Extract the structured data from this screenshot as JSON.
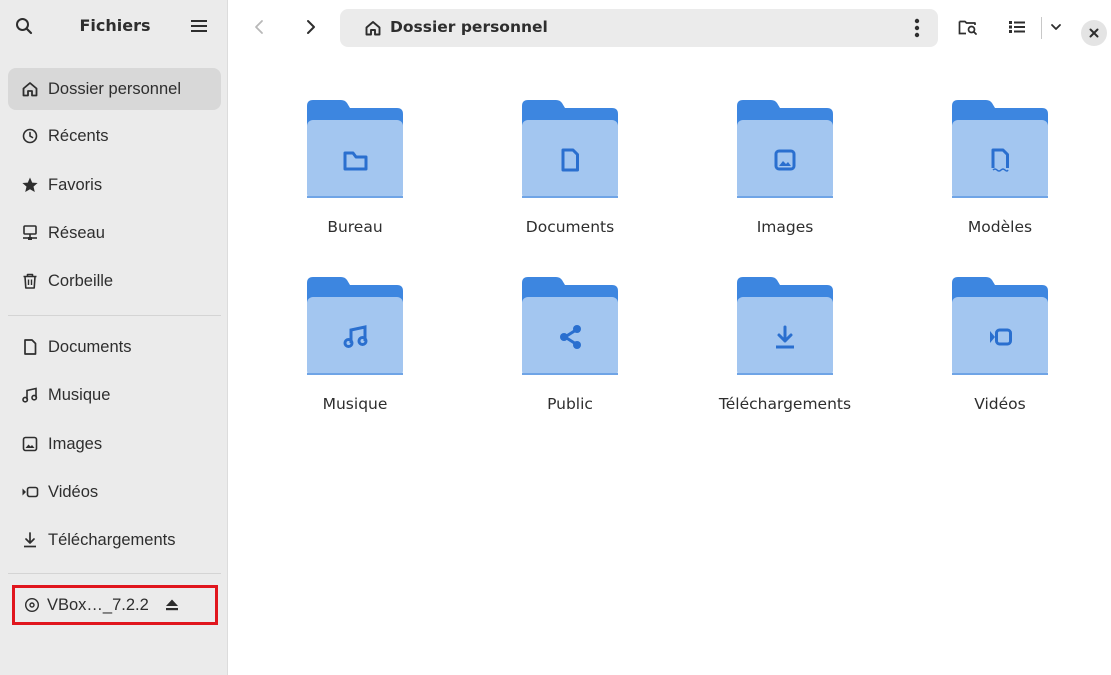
{
  "app": {
    "title": "Fichiers"
  },
  "header": {
    "path_label": "Dossier personnel"
  },
  "sidebar": {
    "places": [
      {
        "label": "Dossier personnel",
        "icon": "home-icon",
        "active": true
      },
      {
        "label": "Récents",
        "icon": "clock-icon"
      },
      {
        "label": "Favoris",
        "icon": "star-icon"
      },
      {
        "label": "Réseau",
        "icon": "network-icon"
      },
      {
        "label": "Corbeille",
        "icon": "trash-icon"
      }
    ],
    "bookmarks": [
      {
        "label": "Documents",
        "icon": "document-icon"
      },
      {
        "label": "Musique",
        "icon": "music-icon"
      },
      {
        "label": "Images",
        "icon": "image-icon"
      },
      {
        "label": "Vidéos",
        "icon": "video-icon"
      },
      {
        "label": "Téléchargements",
        "icon": "download-icon"
      }
    ],
    "devices": [
      {
        "label": "VBox…_7.2.2",
        "icon": "disc-icon",
        "eject_icon": "eject-icon",
        "highlighted": true
      }
    ]
  },
  "folders": [
    {
      "label": "Bureau",
      "icon": "folder-desktop-icon"
    },
    {
      "label": "Documents",
      "icon": "folder-documents-icon"
    },
    {
      "label": "Images",
      "icon": "folder-pictures-icon"
    },
    {
      "label": "Modèles",
      "icon": "folder-templates-icon"
    },
    {
      "label": "Musique",
      "icon": "folder-music-icon"
    },
    {
      "label": "Public",
      "icon": "folder-publicshare-icon"
    },
    {
      "label": "Téléchargements",
      "icon": "folder-download-icon"
    },
    {
      "label": "Vidéos",
      "icon": "folder-videos-icon"
    }
  ],
  "colors": {
    "folder_back": "#3d86e0",
    "folder_front": "#a3c6f0",
    "folder_glyph": "#2a6fcf",
    "highlight_border": "#e0161d",
    "sidebar_bg": "#ebebeb"
  }
}
